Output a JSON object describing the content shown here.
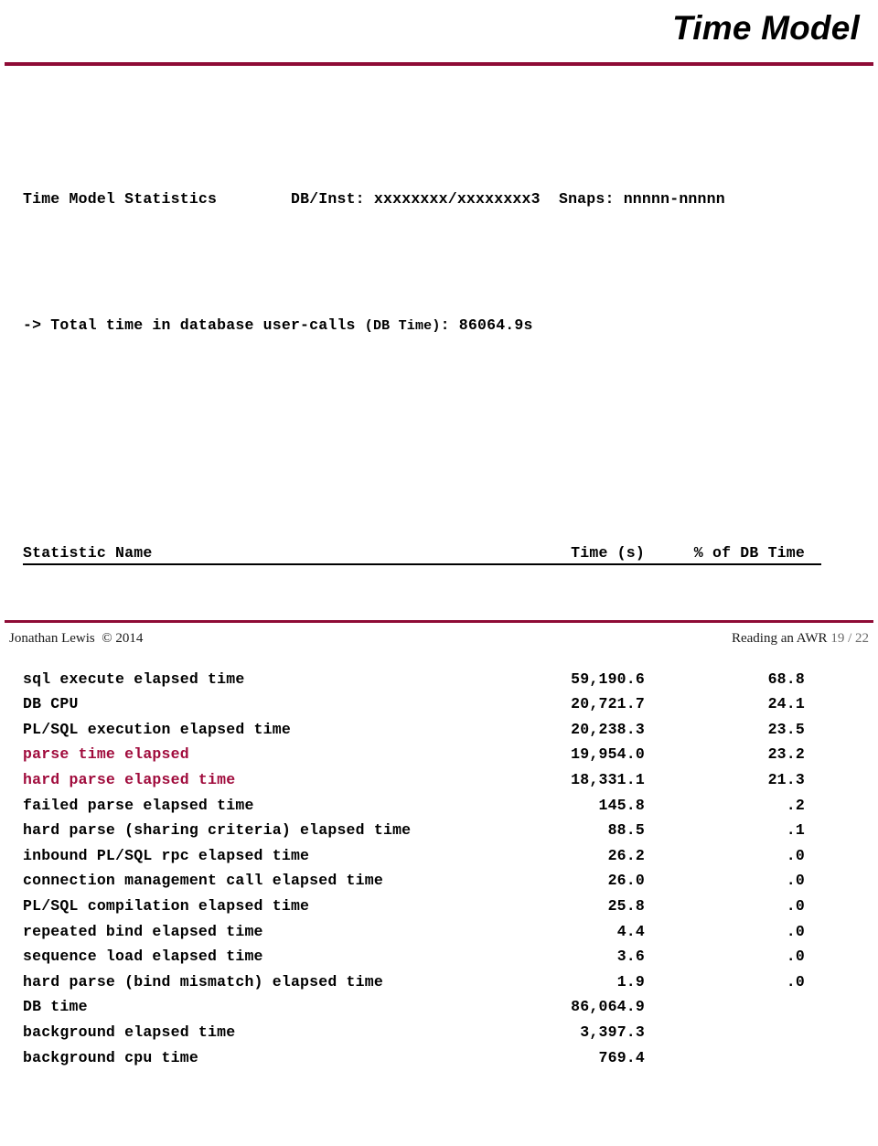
{
  "slide": {
    "title": "Time Model",
    "accent_color": "#8E0B36",
    "highlight_color": "#A00B3C"
  },
  "report": {
    "header_line1": {
      "left": "Time Model Statistics",
      "db_inst_label": "DB/Inst:",
      "db_inst_value": "xxxxxxxx/xxxxxxxx3",
      "snaps_label": "Snaps:",
      "snaps_value": "nnnnn-nnnnn"
    },
    "header_line2": {
      "prefix": "-> Total time in database user-calls ",
      "paren": "(DB Time)",
      "suffix": ": 86064.9s"
    },
    "columns": {
      "name": "Statistic Name",
      "time": "Time (s)",
      "pct": "% of DB Time"
    },
    "rows": [
      {
        "name": "sql execute elapsed time",
        "time": "59,190.6",
        "pct": "68.8",
        "highlight": false
      },
      {
        "name": "DB CPU",
        "time": "20,721.7",
        "pct": "24.1",
        "highlight": false
      },
      {
        "name": "PL/SQL execution elapsed time",
        "time": "20,238.3",
        "pct": "23.5",
        "highlight": false
      },
      {
        "name": "parse time elapsed",
        "time": "19,954.0",
        "pct": "23.2",
        "highlight": true
      },
      {
        "name": "hard parse elapsed time",
        "time": "18,331.1",
        "pct": "21.3",
        "highlight": true
      },
      {
        "name": "failed parse elapsed time",
        "time": "145.8",
        "pct": ".2",
        "highlight": false
      },
      {
        "name": "hard parse (sharing criteria) elapsed time",
        "time": "88.5",
        "pct": ".1",
        "highlight": false
      },
      {
        "name": "inbound PL/SQL rpc elapsed time",
        "time": "26.2",
        "pct": ".0",
        "highlight": false
      },
      {
        "name": "connection management call elapsed time",
        "time": "26.0",
        "pct": ".0",
        "highlight": false
      },
      {
        "name": "PL/SQL compilation elapsed time",
        "time": "25.8",
        "pct": ".0",
        "highlight": false
      },
      {
        "name": "repeated bind elapsed time",
        "time": "4.4",
        "pct": ".0",
        "highlight": false
      },
      {
        "name": "sequence load elapsed time",
        "time": "3.6",
        "pct": ".0",
        "highlight": false
      },
      {
        "name": "hard parse (bind mismatch) elapsed time",
        "time": "1.9",
        "pct": ".0",
        "highlight": false
      },
      {
        "name": "DB time",
        "time": "86,064.9",
        "pct": "",
        "highlight": false
      },
      {
        "name": "background elapsed time",
        "time": "3,397.3",
        "pct": "",
        "highlight": false
      },
      {
        "name": "background cpu time",
        "time": "769.4",
        "pct": "",
        "highlight": false
      }
    ]
  },
  "footer": {
    "author": "Jonathan Lewis",
    "copyright": "© 2014",
    "deck": "Reading an AWR",
    "page": "19 / 22"
  }
}
